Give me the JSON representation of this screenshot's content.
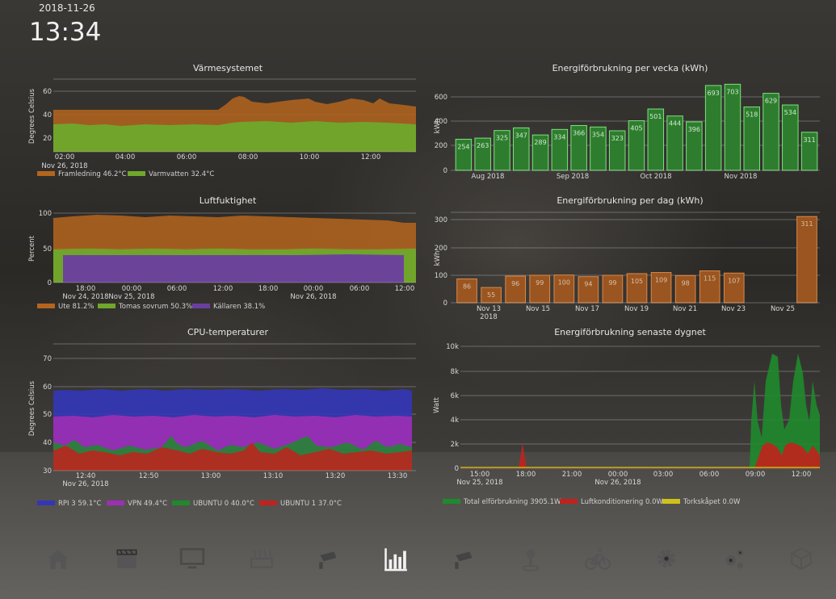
{
  "header": {
    "date": "2018-11-26",
    "time": "13:34"
  },
  "colors": {
    "orange": "#b5651d",
    "green": "#6fa82c",
    "purple": "#6a3fa0",
    "blue": "#3436b8",
    "magenta": "#9d2fb4",
    "red": "#c2221d",
    "darkgreen": "#1f8a2c",
    "yellow": "#cfc21a"
  },
  "charts": {
    "heating": {
      "title": "Värmesystemet",
      "ylabel": "Degrees Celsius",
      "yticks": [
        "20",
        "40",
        "60"
      ],
      "xticks": [
        "02:00",
        "04:00",
        "06:00",
        "08:00",
        "10:00",
        "12:00"
      ],
      "xsub": "Nov 26, 2018",
      "legend": [
        "Framledning 46.2°C",
        "Varmvatten 32.4°C"
      ]
    },
    "humidity": {
      "title": "Luftfuktighet",
      "ylabel": "Percent",
      "yticks": [
        "0",
        "50",
        "100"
      ],
      "xticks": [
        "18:00",
        "00:00",
        "06:00",
        "12:00",
        "18:00",
        "00:00",
        "06:00",
        "12:00"
      ],
      "xsub": [
        "Nov 24, 2018",
        "Nov 25, 2018",
        "Nov 26, 2018"
      ],
      "legend": [
        "Ute 81.2%",
        "Tomas sovrum 50.3%",
        "Källaren 38.1%"
      ]
    },
    "cpu": {
      "title": "CPU-temperaturer",
      "ylabel": "Degrees Celsius",
      "yticks": [
        "30",
        "40",
        "50",
        "60",
        "70"
      ],
      "xticks": [
        "12:40",
        "12:50",
        "13:00",
        "13:10",
        "13:20",
        "13:30"
      ],
      "xsub": "Nov 26, 2018",
      "legend": [
        "RPI 3 59.1°C",
        "VPN 49.4°C",
        "UBUNTU 0 40.0°C",
        "UBUNTU 1 37.0°C"
      ]
    },
    "weekly": {
      "title": "Energiförbrukning per vecka (kWh)",
      "ylabel": "kWh",
      "yticks": [
        "0",
        "200",
        "400",
        "600"
      ],
      "xticks": [
        "Aug 2018",
        "Sep 2018",
        "Oct 2018",
        "Nov 2018"
      ]
    },
    "daily": {
      "title": "Energiförbrukning per dag (kWh)",
      "ylabel": "kWh",
      "yticks": [
        "0",
        "100",
        "200",
        "300"
      ],
      "xticks": [
        "Nov 13",
        "Nov 15",
        "Nov 17",
        "Nov 19",
        "Nov 21",
        "Nov 23",
        "Nov 25"
      ],
      "xsub": "2018"
    },
    "power": {
      "title": "Energiförbrukning senaste dygnet",
      "ylabel": "Watt",
      "yticks": [
        "0",
        "2k",
        "4k",
        "6k",
        "8k",
        "10k"
      ],
      "xticks": [
        "15:00",
        "18:00",
        "21:00",
        "00:00",
        "03:00",
        "06:00",
        "09:00",
        "12:00"
      ],
      "xsub": [
        "Nov 25, 2018",
        "Nov 26, 2018"
      ],
      "legend": [
        "Total elförbrukning 3905.1W",
        "Luftkonditionering 0.0W",
        "Torkskåpet 0.0W"
      ]
    }
  },
  "chart_data": [
    {
      "type": "area",
      "title": "Värmesystemet",
      "ylabel": "Degrees Celsius",
      "ylim": [
        12,
        68
      ],
      "x": [
        "01:00",
        "02:00",
        "03:00",
        "04:00",
        "05:00",
        "06:00",
        "07:00",
        "07:30",
        "08:00",
        "09:00",
        "10:00",
        "10:30",
        "11:00",
        "12:00",
        "13:00"
      ],
      "series": [
        {
          "name": "Framledning",
          "values": [
            46,
            46,
            46,
            46,
            46,
            46,
            46,
            55,
            55,
            52,
            54,
            51,
            54,
            48,
            46
          ]
        },
        {
          "name": "Varmvatten",
          "values": [
            30,
            31,
            31,
            31,
            31,
            31,
            31,
            33,
            34,
            34,
            34,
            34,
            34,
            34,
            32
          ]
        }
      ]
    },
    {
      "type": "area",
      "title": "Luftfuktighet",
      "ylabel": "Percent",
      "ylim": [
        0,
        110
      ],
      "x": [
        "Nov 24 12:00",
        "Nov 24 18:00",
        "Nov 25 00:00",
        "Nov 25 06:00",
        "Nov 25 12:00",
        "Nov 25 18:00",
        "Nov 26 00:00",
        "Nov 26 06:00",
        "Nov 26 12:00"
      ],
      "series": [
        {
          "name": "Ute",
          "values": [
            90,
            94,
            93,
            92,
            91,
            92,
            88,
            87,
            81
          ]
        },
        {
          "name": "Tomas sovrum",
          "values": [
            50,
            51,
            51,
            51,
            50,
            51,
            50,
            50,
            50
          ]
        },
        {
          "name": "Källaren",
          "values": [
            38,
            38,
            38,
            38,
            38,
            38,
            38,
            38,
            38
          ]
        }
      ]
    },
    {
      "type": "area",
      "title": "CPU-temperaturer",
      "ylabel": "Degrees Celsius",
      "ylim": [
        30,
        75
      ],
      "x": [
        "12:35",
        "12:40",
        "12:45",
        "12:50",
        "12:55",
        "13:00",
        "13:05",
        "13:10",
        "13:15",
        "13:20",
        "13:25",
        "13:30",
        "13:35"
      ],
      "series": [
        {
          "name": "RPI 3",
          "values": [
            58,
            58,
            59,
            58,
            59,
            58,
            59,
            59,
            58,
            59,
            58,
            59,
            59
          ]
        },
        {
          "name": "VPN",
          "values": [
            49,
            49,
            49,
            48,
            49,
            49,
            49,
            48,
            49,
            49,
            49,
            49,
            49
          ]
        },
        {
          "name": "UBUNTU 0",
          "values": [
            39,
            40,
            38,
            39,
            41,
            40,
            42,
            41,
            40,
            42,
            40,
            41,
            40
          ]
        },
        {
          "name": "UBUNTU 1",
          "values": [
            38,
            37,
            39,
            38,
            37,
            40,
            38,
            37,
            38,
            39,
            37,
            38,
            37
          ]
        }
      ]
    },
    {
      "type": "bar",
      "title": "Energiförbrukning per vecka (kWh)",
      "ylabel": "kWh",
      "ylim": [
        0,
        750
      ],
      "values": [
        254,
        263,
        325,
        347,
        289,
        334,
        366,
        354,
        323,
        405,
        501,
        444,
        396,
        693,
        703,
        518,
        629,
        534,
        311
      ]
    },
    {
      "type": "bar",
      "title": "Energiförbrukning per dag (kWh)",
      "ylabel": "kWh",
      "ylim": [
        0,
        330
      ],
      "values": [
        86,
        55,
        96,
        99,
        100,
        94,
        99,
        105,
        109,
        98,
        115,
        107,
        null,
        null,
        311
      ]
    },
    {
      "type": "area",
      "title": "Energiförbrukning senaste dygnet",
      "ylabel": "Watt",
      "ylim": [
        0,
        10500
      ],
      "x": [
        "13:00",
        "15:00",
        "17:00",
        "18:00",
        "21:00",
        "00:00",
        "03:00",
        "06:00",
        "08:30",
        "09:00",
        "10:00",
        "11:00",
        "12:00",
        "13:00"
      ],
      "series": [
        {
          "name": "Total elförbrukning",
          "values": [
            0,
            0,
            0,
            0,
            0,
            0,
            0,
            0,
            0,
            7000,
            9400,
            5500,
            9300,
            3905
          ]
        },
        {
          "name": "Luftkonditionering",
          "values": [
            0,
            0,
            0,
            2100,
            0,
            0,
            0,
            0,
            0,
            1800,
            2000,
            1600,
            2000,
            0
          ]
        },
        {
          "name": "Torkskåpet",
          "values": [
            0,
            0,
            0,
            0,
            0,
            0,
            0,
            0,
            0,
            0,
            0,
            0,
            0,
            0
          ]
        }
      ]
    }
  ],
  "nav": [
    {
      "name": "home-icon"
    },
    {
      "name": "media-clapper-icon"
    },
    {
      "name": "monitor-icon"
    },
    {
      "name": "radiator-icon"
    },
    {
      "name": "security-camera-icon"
    },
    {
      "name": "bar-chart-icon",
      "active": true
    },
    {
      "name": "security-camera-icon-2"
    },
    {
      "name": "location-pin-icon"
    },
    {
      "name": "bicycle-icon"
    },
    {
      "name": "gear-icon"
    },
    {
      "name": "gears-icon"
    },
    {
      "name": "cube-icon"
    }
  ]
}
